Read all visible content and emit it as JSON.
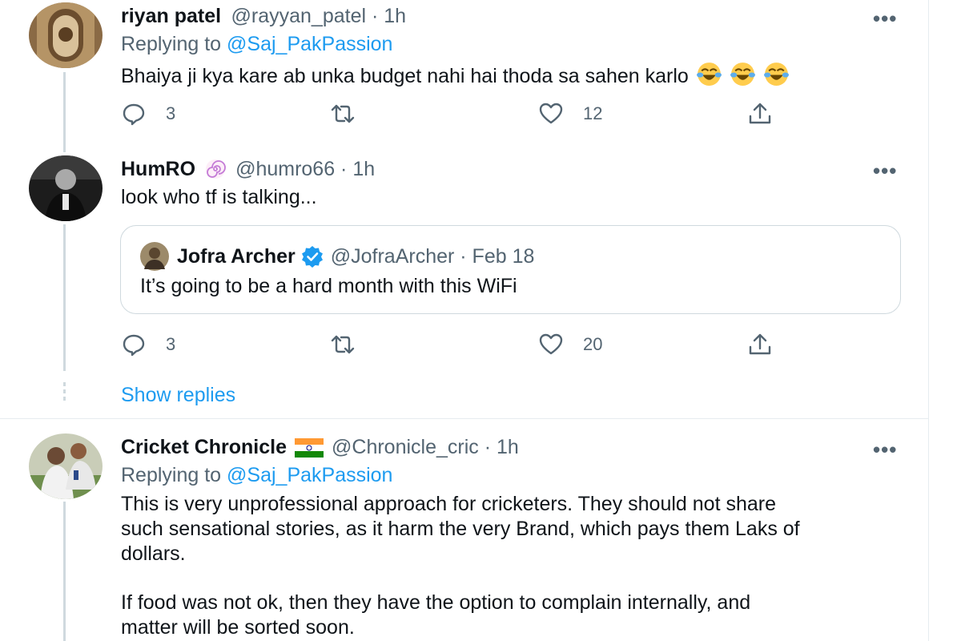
{
  "tweets": [
    {
      "name": "riyan patel",
      "meta": "@rayyan_patel · 1h",
      "replying_prefix": "Replying to",
      "replying_handle": "@Saj_PakPassion",
      "text": "Bhaiya ji kya kare ab unka budget nahi hai thoda sa sahen karlo",
      "emojis": [
        "face-with-tears-of-joy",
        "face-with-tears-of-joy",
        "face-with-tears-of-joy"
      ],
      "reply_count": "3",
      "like_count": "12"
    },
    {
      "name": "HumRO",
      "meta": "@humro66 · 1h",
      "text": "look who tf is talking...",
      "quote": {
        "name": "Jofra Archer",
        "meta": "@JofraArcher · Feb 18",
        "text": "It’s going to be a hard month with this WiFi"
      },
      "reply_count": "3",
      "like_count": "20",
      "show_replies": "Show replies"
    },
    {
      "name": "Cricket Chronicle",
      "meta": "@Chronicle_cric · 1h",
      "replying_prefix": "Replying to",
      "replying_handle": "@Saj_PakPassion",
      "text_lines": [
        "This is very unprofessional approach for cricketers. They should not share",
        "such sensational stories, as it harm the very Brand, which pays them Laks of",
        "dollars.",
        "If food was not ok, then they have the option to complain internally, and",
        "matter will be sorted soon."
      ]
    }
  ],
  "more_label": "•••",
  "colors": {
    "link": "#1d9bf0",
    "secondary_text": "#536471",
    "verified": "#1d9bf0",
    "border": "#cfd9de"
  }
}
